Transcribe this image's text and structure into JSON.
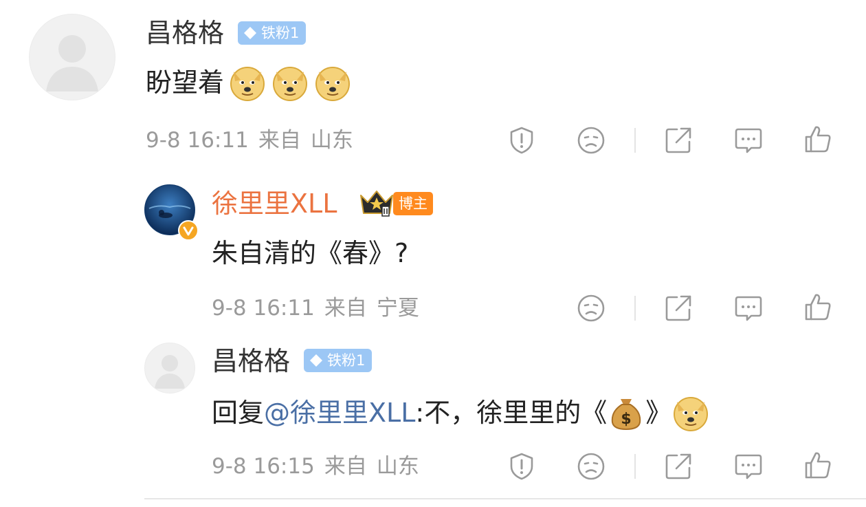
{
  "comments": [
    {
      "user": "昌格格",
      "badge": "铁粉1",
      "text": "盼望着",
      "emoji_count": 3,
      "time": "9-8 16:11",
      "from_label": "来自",
      "location": "山东"
    },
    {
      "user": "徐里里XLL",
      "badge": "博主",
      "text": "朱自清的《春》?",
      "time": "9-8 16:11",
      "from_label": "来自",
      "location": "宁夏"
    },
    {
      "user": "昌格格",
      "badge": "铁粉1",
      "reply_prefix": "回复",
      "mention": "@徐里里XLL",
      "reply_body": ":不，徐里里的《",
      "reply_suffix": "》",
      "time": "9-8 16:15",
      "from_label": "来自",
      "location": "山东"
    }
  ],
  "icons": [
    "report-icon",
    "dislike-icon",
    "share-icon",
    "reply-icon",
    "like-icon"
  ],
  "colors": {
    "blogger_name": "#eb7340",
    "mention": "#4a6fa5",
    "fan_badge": "#9cc7f5",
    "blogger_badge": "#ff8a1e",
    "meta_text": "#9a9a9a"
  }
}
